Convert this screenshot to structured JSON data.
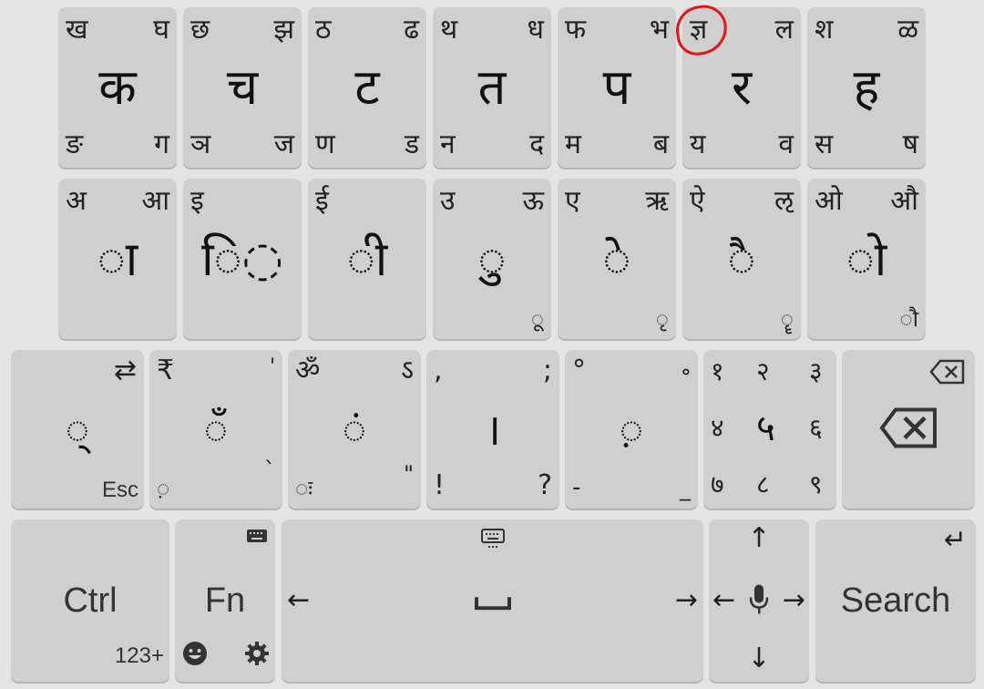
{
  "row1": [
    {
      "tl": "ख",
      "tr": "घ",
      "main": "क",
      "bl": "ङ",
      "br": "ग"
    },
    {
      "tl": "छ",
      "tr": "झ",
      "main": "च",
      "bl": "ञ",
      "br": "ज"
    },
    {
      "tl": "ठ",
      "tr": "ढ",
      "main": "ट",
      "bl": "ण",
      "br": "ड"
    },
    {
      "tl": "थ",
      "tr": "ध",
      "main": "त",
      "bl": "न",
      "br": "द"
    },
    {
      "tl": "फ",
      "tr": "भ",
      "main": "प",
      "bl": "म",
      "br": "ब"
    },
    {
      "tl": "ज्ञ",
      "tr": "ल",
      "main": "र",
      "bl": "य",
      "br": "व"
    },
    {
      "tl": "श",
      "tr": "ळ",
      "main": "ह",
      "bl": "स",
      "br": "ष"
    }
  ],
  "row2": [
    {
      "tl": "अ",
      "tr": "आ",
      "main": "◌ा",
      "br": ""
    },
    {
      "tl": "इ",
      "tr": "",
      "main": "ि◌",
      "br": ""
    },
    {
      "tl": "ई",
      "tr": "",
      "main": "◌ी",
      "br": ""
    },
    {
      "tl": "उ",
      "tr": "ऊ",
      "main": "◌ु",
      "br": "◌ू"
    },
    {
      "tl": "ए",
      "tr": "ऋ",
      "main": "◌े",
      "br": "◌ृ"
    },
    {
      "tl": "ऐ",
      "tr": "ऌ",
      "main": "◌ै",
      "br": "◌ॄ"
    },
    {
      "tl": "ओ",
      "tr": "औ",
      "main": "◌ो",
      "br": "◌ौ"
    }
  ],
  "row3": {
    "virama": {
      "tr": "⇄",
      "main": "◌्",
      "bl": "Esc"
    },
    "candrabindu": {
      "tl": "₹",
      "tr": "'",
      "main": "◌ँ",
      "bl": "◌़",
      "br": "`"
    },
    "anusvara": {
      "tl": "ॐ",
      "tr": "ऽ",
      "main": "◌ं",
      "bl": "◌ः",
      "br": "\""
    },
    "danda": {
      "tl": ",",
      "tr": ";",
      "main": "।",
      "bl": "!",
      "br": "?"
    },
    "nukta": {
      "tl": "°",
      "tr": "॰",
      "main": "◌़",
      "bl": "-",
      "br": "_"
    },
    "numpad": [
      "१",
      "२",
      "३",
      "४",
      "५",
      "६",
      "७",
      "८",
      "९"
    ],
    "backspace": {
      "label": "⌫"
    }
  },
  "row4": {
    "ctrl": {
      "label": "Ctrl",
      "sub": "123+"
    },
    "fn": {
      "label": "Fn"
    },
    "space": {
      "left": "←",
      "right": "→"
    },
    "nav": {
      "up": "↑",
      "down": "↓",
      "left": "←",
      "right": "→",
      "mic": "🎤"
    },
    "search": {
      "label": "Search",
      "enter": "↵"
    }
  },
  "colors": {
    "background": "#e4e4e4",
    "key": "#cfcfcf",
    "highlight": "#e21818"
  }
}
